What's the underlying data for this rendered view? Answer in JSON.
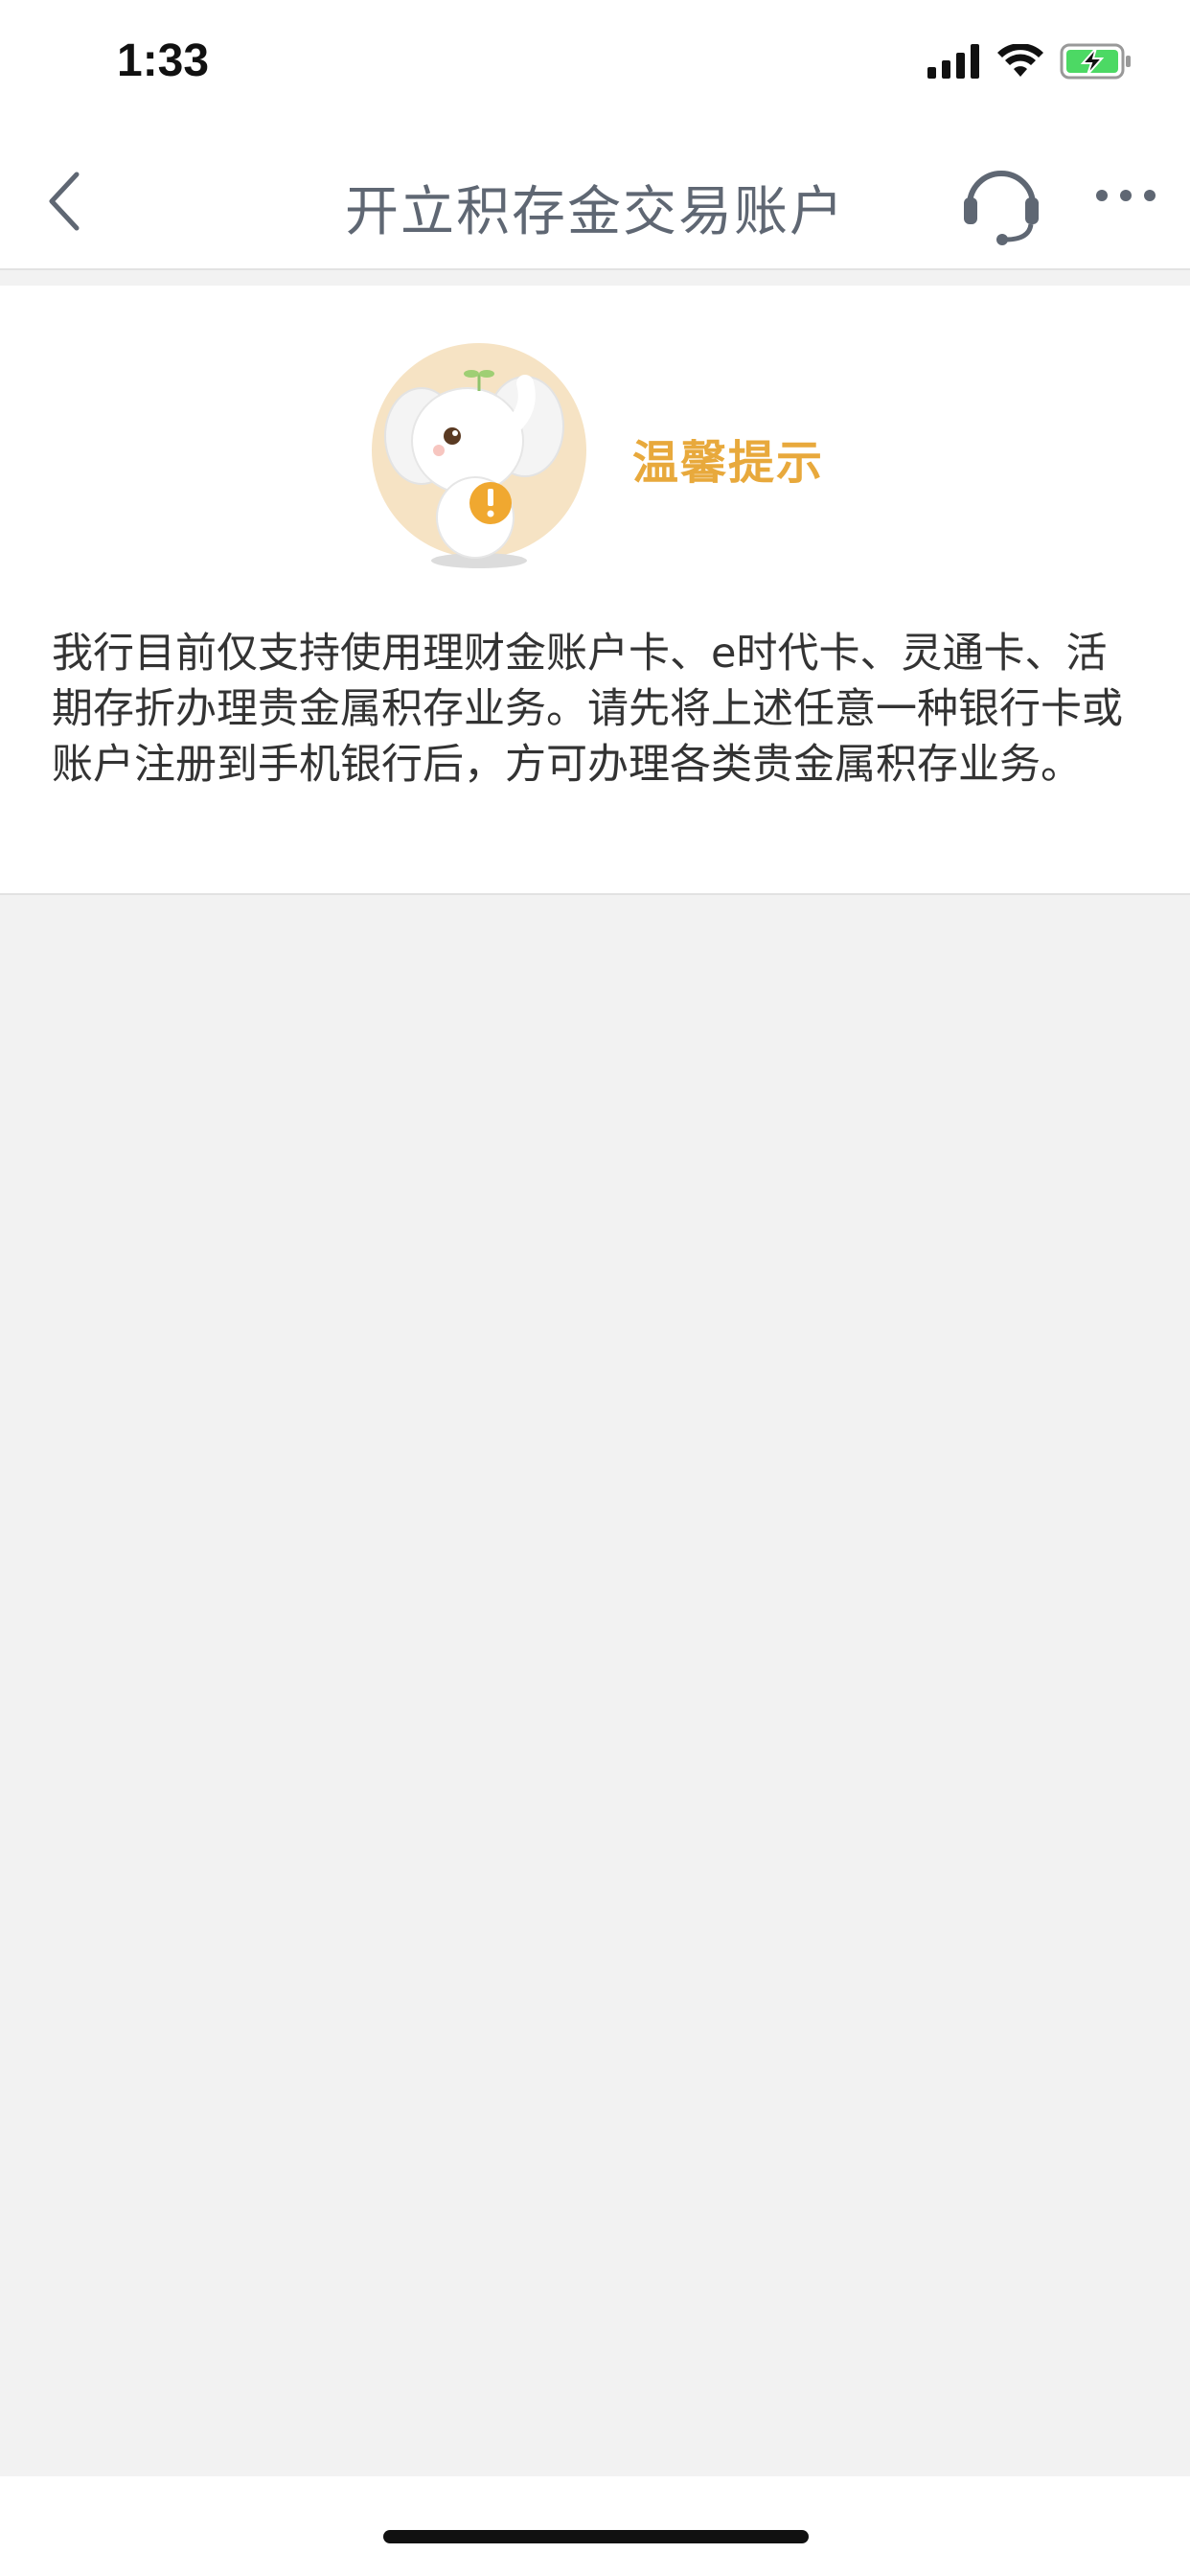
{
  "status_bar": {
    "time": "1:33",
    "icons": [
      "signal-icon",
      "wifi-icon",
      "battery-charging-icon"
    ]
  },
  "nav": {
    "title": "开立积存金交易账户",
    "back_icon": "chevron-left-icon",
    "service_icon": "headset-icon",
    "more_icon": "more-dots-icon"
  },
  "notice": {
    "mascot_icon": "elephant-mascot-icon",
    "title": "温馨提示",
    "body": "我行目前仅支持使用理财金账户卡、e时代卡、灵通卡、活期存折办理贵金属积存业务。请先将上述任意一种银行卡或账户注册到手机银行后，方可办理各类贵金属积存业务。"
  },
  "colors": {
    "accent": "#e8a93c",
    "nav_text": "#5f6773",
    "background": "#f2f2f2"
  }
}
